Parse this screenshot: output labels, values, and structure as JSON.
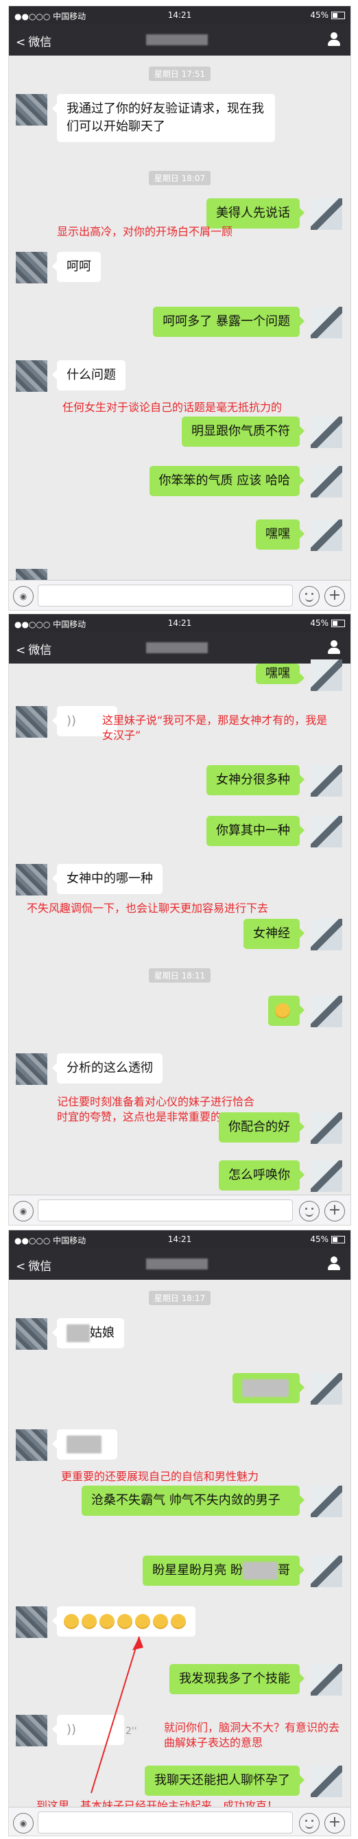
{
  "status": {
    "carrier": "●●○○○ 中国移动",
    "battery": "45%"
  },
  "times": {
    "shot1": "14:21",
    "shot2": "14:21",
    "shot3": "14:21"
  },
  "nav": {
    "back_label": "微信"
  },
  "icons": {
    "back": "chevron-left-icon",
    "profile": "person-icon",
    "voice": "voice-icon",
    "emoji": "emoji-icon",
    "plus": "plus-icon"
  },
  "shot1": {
    "ts1": "星期日 17:51",
    "ts2": "星期日 18:07",
    "m1": "我通过了你的好友验证请求，现在我们可以开始聊天了",
    "m2": "美得人先说话",
    "note1": "显示出高冷，对你的开场白不屑一顾",
    "m3": "呵呵",
    "m4": "呵呵多了 暴露一个问题",
    "m5": "什么问题",
    "note2": "任何女生对于谈论自己的话题是毫无抵抗力的",
    "m6": "明显跟你气质不符",
    "m7": "你笨笨的气质 应该 哈哈",
    "m8": "嘿嘿"
  },
  "shot2": {
    "m1": "嘿嘿",
    "note1": "这里妹子说“我可不是，那是女神才有的，我是女汉子”",
    "m2": "女神分很多种",
    "m3": "你算其中一种",
    "m4": "女神中的哪一种",
    "note2": "不失风趣调侃一下，也会让聊天更加容易进行下去",
    "m5": "女神经",
    "ts1": "星期日 18:11",
    "m6": "分析的这么透彻",
    "note3": "记住要时刻准备着对心仪的妹子进行恰合时宜的夸赞，这点也是非常重要的",
    "m7": "你配合的好",
    "m8": "怎么呼唤你"
  },
  "shot3": {
    "ts1": "星期日 18:17",
    "m1": "姑娘",
    "note1": "更重要的还要展现自己的自信和男性魅力",
    "m2": "沧桑不失霸气 帅气不失内敛的男子",
    "m3": "盼星星盼月亮 盼",
    "m3b": "哥",
    "m4": "我发现我多了个技能",
    "voice_len": "2''",
    "note2": "就问你们，脑洞大不大？有意识的去曲解妹子表达的意思",
    "m5": "我聊天还能把人聊怀孕了",
    "note3": "到这里，基本妹子已经开始主动起来，成功攻克！"
  }
}
